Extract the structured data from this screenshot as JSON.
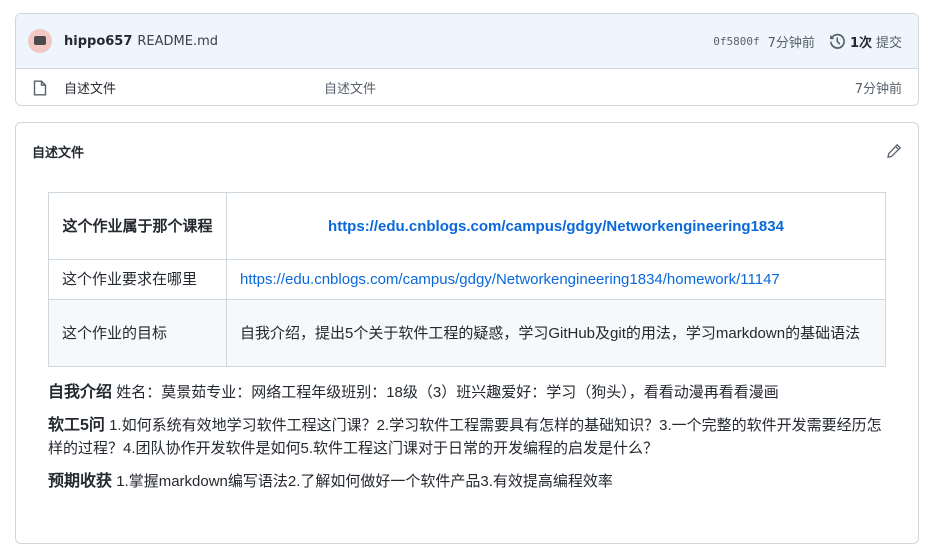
{
  "commit": {
    "author": "hippo657",
    "message": "README.md",
    "sha": "0f5800f",
    "time": "7分钟前",
    "history_count": "1次",
    "history_label": "提交"
  },
  "file": {
    "name": "自述文件",
    "commit_message": "自述文件",
    "time": "7分钟前"
  },
  "readme": {
    "title": "自述文件",
    "table": [
      [
        "这个作业属于那个课程",
        "https://edu.cnblogs.com/campus/gdgy/Networkengineering1834"
      ],
      [
        "这个作业要求在哪里",
        "https://edu.cnblogs.com/campus/gdgy/Networkengineering1834/homework/11147"
      ],
      [
        "这个作业的目标",
        "自我介绍，提出5个关于软件工程的疑惑，学习GitHub及git的用法，学习markdown的基础语法"
      ]
    ],
    "intro_label": "自我介绍",
    "intro_text": "姓名：莫景茹专业：网络工程年级班别：18级（3）班兴趣爱好：学习（狗头），看看动漫再看看漫画",
    "questions_label": "软工5问",
    "questions_text": "1.如何系统有效地学习软件工程这门课？2.学习软件工程需要具有怎样的基础知识？3.一个完整的软件开发需要经历怎样的过程？4.团队协作开发软件是如何5.软件工程这门课对于日常的开发编程的启发是什么？",
    "expect_label": "预期收获",
    "expect_text": "1.掌握markdown编写语法2.了解如何做好一个软件产品3.有效提高编程效率"
  },
  "colors": {
    "link": "#0969da",
    "header_bg": "#eef5fd",
    "border": "#d0d7de"
  },
  "icons": [
    "avatar",
    "history-icon",
    "file-icon",
    "pencil-icon"
  ]
}
